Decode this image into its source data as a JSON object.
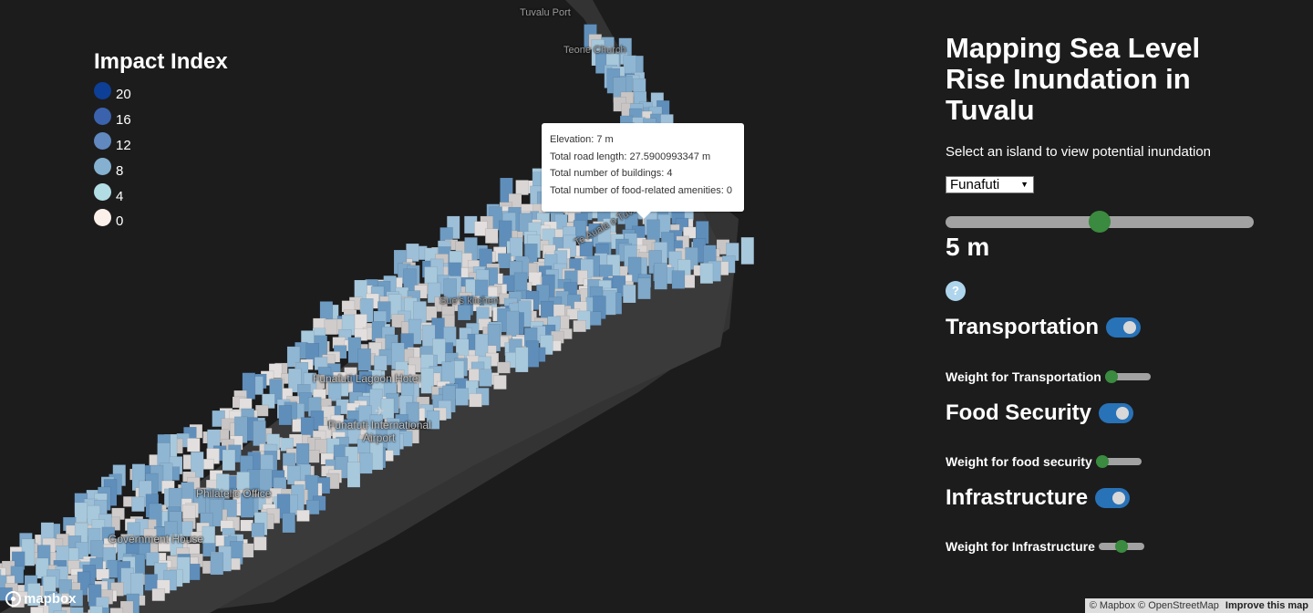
{
  "legend": {
    "title": "Impact Index",
    "items": [
      {
        "label": "20",
        "color": "#0d3f96"
      },
      {
        "label": "16",
        "color": "#3b62ac"
      },
      {
        "label": "12",
        "color": "#6189c0"
      },
      {
        "label": "8",
        "color": "#85b0cf"
      },
      {
        "label": "4",
        "color": "#b3dde4"
      },
      {
        "label": "0",
        "color": "#fcf0ea"
      }
    ]
  },
  "popup": {
    "elevation": "Elevation: 7 m",
    "road_length": "Total road length: 27.5900993347 m",
    "buildings": "Total number of buildings: 4",
    "food_amenities": "Total number of food-related amenities: 0"
  },
  "map": {
    "labels": {
      "tuvalu_port": "Tuvalu Port",
      "teone_church": "Teone Church",
      "road": "Te Auala o Tuvalu",
      "kitchen": "Sue's kitchen",
      "lagoon_hotel": "Funafuti Lagoon Hotel",
      "airport_line1": "Funafuti International",
      "airport_line2": "Airport",
      "post_office": "Philatelic Office",
      "government_house": "Government House"
    },
    "colors": {
      "background": "#1c1c1c",
      "land": "#3a3a3a",
      "low_impact": "#d9d6d5",
      "high_impact": "#6189c0"
    }
  },
  "panel": {
    "title": "Mapping Sea Level Rise Inundation in Tuvalu",
    "instructions": "Select an island to view potential inundation",
    "island_select": {
      "value": "Funafuti",
      "arrow": "▼"
    },
    "sea_level": {
      "value": 5,
      "min": 0,
      "max": 10,
      "display": "5 m"
    },
    "help_icon": "?",
    "layers": [
      {
        "name": "Transportation",
        "enabled": true,
        "weight_label": "Weight for Transportation",
        "weight": 0
      },
      {
        "name": "Food Security",
        "enabled": true,
        "weight_label": "Weight for food security",
        "weight": 0
      },
      {
        "name": "Infrastructure",
        "enabled": true,
        "weight_label": "Weight for Infrastructure",
        "weight": 0.5
      }
    ],
    "accent_color": "#3a8a3f",
    "toggle_color": "#2872b8"
  },
  "attribution": {
    "logo": "mapbox",
    "text": "© Mapbox © OpenStreetMap",
    "improve": "Improve this map"
  }
}
